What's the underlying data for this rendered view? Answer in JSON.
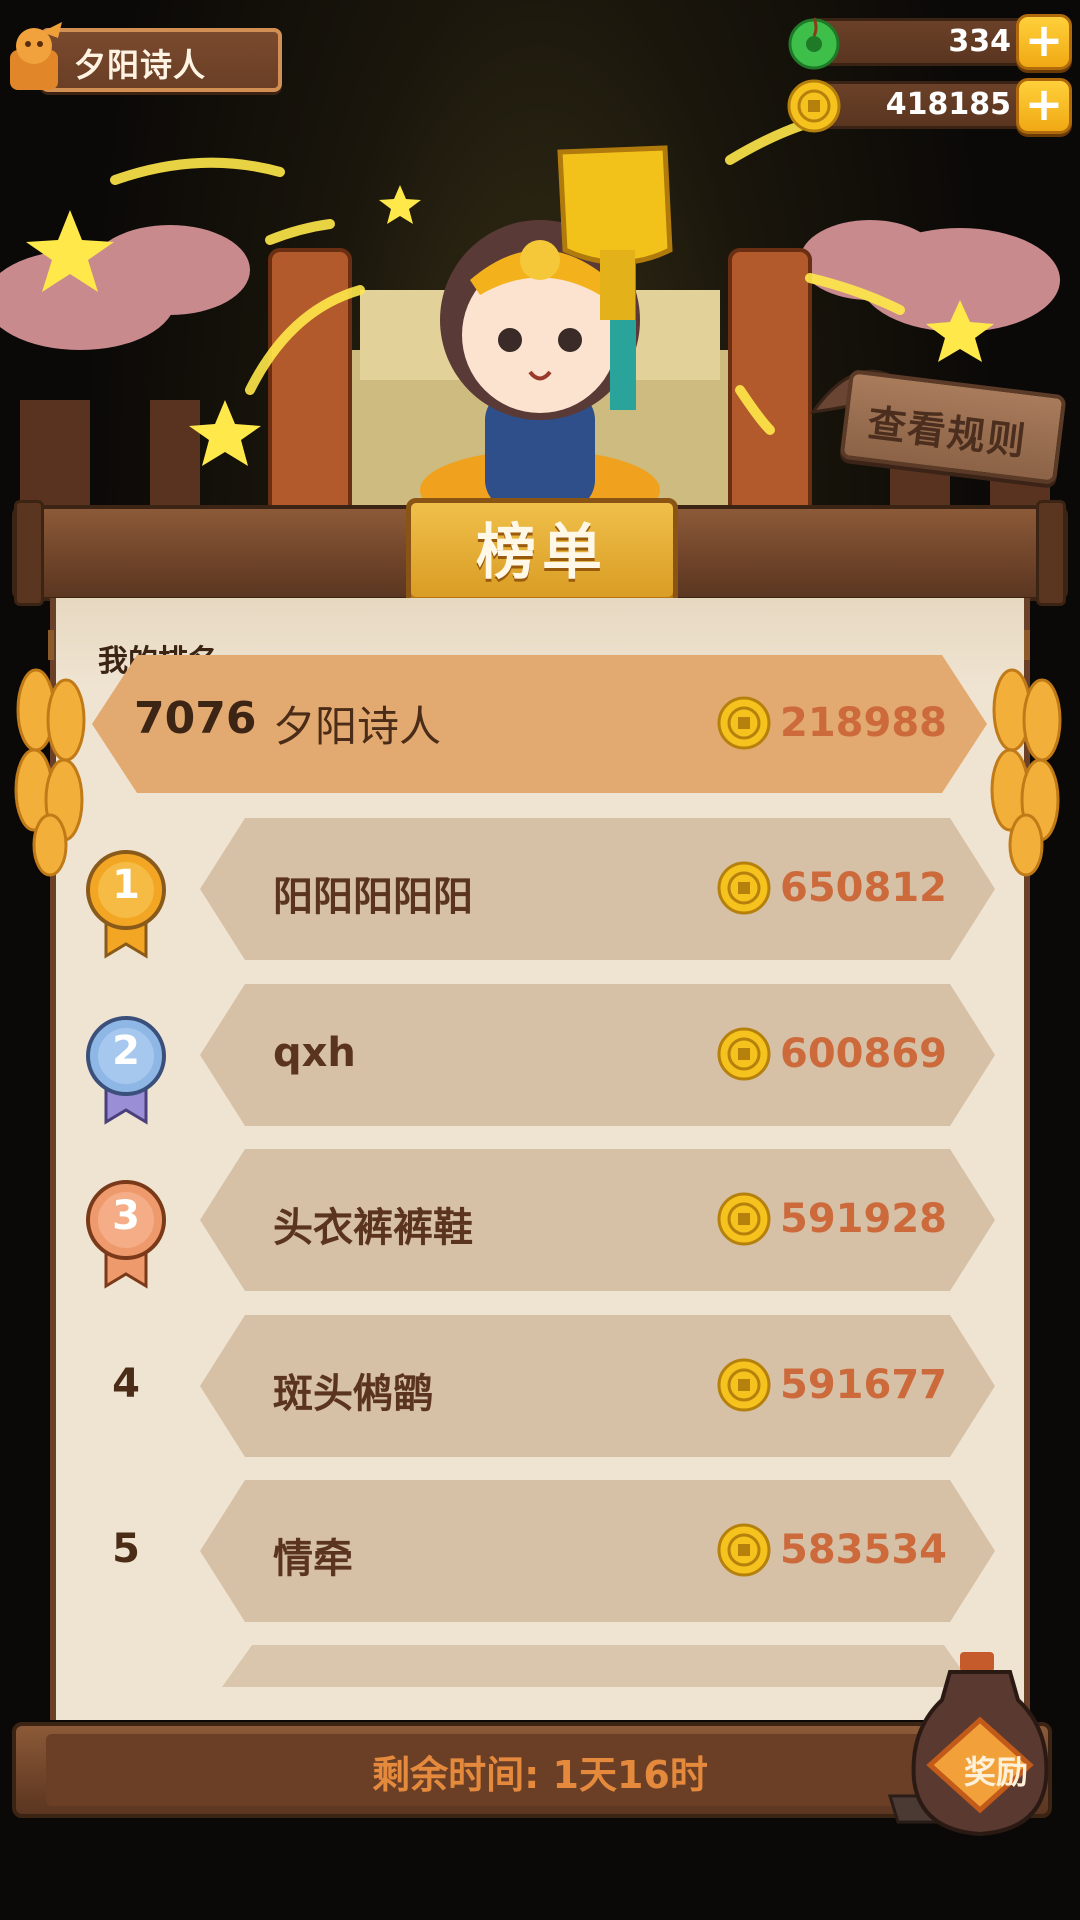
{
  "player": {
    "name": "夕阳诗人"
  },
  "currency": {
    "jade": {
      "value": "334",
      "icon": "jade-icon"
    },
    "coins": {
      "value": "418185",
      "icon": "coin-icon"
    },
    "plus_label": "+"
  },
  "rules_label": "查看规则",
  "title": "榜单",
  "my_rank": {
    "label": "我的排名",
    "rank": "7076",
    "name": "夕阳诗人",
    "score": "218988"
  },
  "leaderboard": [
    {
      "rank": "1",
      "name": "阳阳阳阳阳",
      "score": "650812",
      "badge": "gold"
    },
    {
      "rank": "2",
      "name": "qxh",
      "score": "600869",
      "badge": "silver"
    },
    {
      "rank": "3",
      "name": "头衣裤裤鞋",
      "score": "591928",
      "badge": "bronze"
    },
    {
      "rank": "4",
      "name": "斑头鸺鹠",
      "score": "591677",
      "badge": ""
    },
    {
      "rank": "5",
      "name": "情牵",
      "score": "583534",
      "badge": ""
    }
  ],
  "timer": {
    "label": "剩余时间:",
    "value": "1天16时"
  },
  "reward_label": "奖励",
  "colors": {
    "panel": "#efe4d2",
    "my_row": "#e3ac72",
    "row": "#d6c1a6",
    "score": "#cc6a3c",
    "gold": "#f2a623",
    "silver": "#8fb7e6",
    "bronze": "#ef9a6c"
  }
}
